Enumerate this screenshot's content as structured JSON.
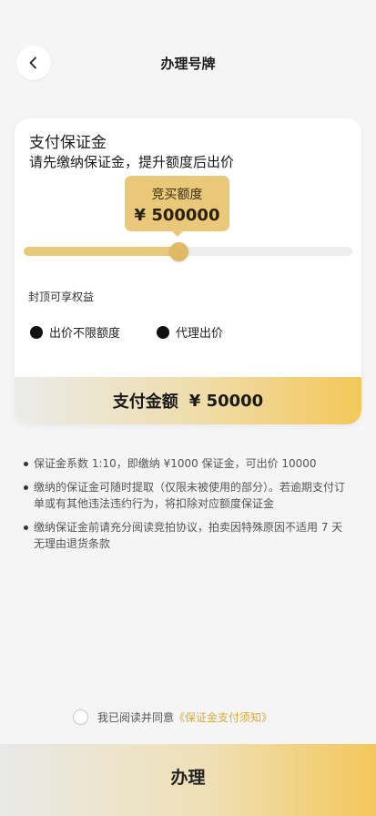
{
  "header": {
    "title": "办理号牌",
    "back_icon": "chevron-left-icon"
  },
  "card": {
    "title": "支付保证金",
    "subtitle": "请先缴纳保证金，提升额度后出价",
    "bid_limit": {
      "label": "竞买额度",
      "value": "¥ 500000"
    },
    "slider": {
      "fraction": 0.47
    },
    "perks": {
      "heading": "封顶可享权益",
      "items": [
        {
          "label": "出价不限额度"
        },
        {
          "label": "代理出价"
        }
      ]
    },
    "payment": {
      "label": "支付金额",
      "amount": "¥ 50000"
    }
  },
  "notes": [
    "保证金系数 1:10，即缴纳 ¥1000 保证金，可出价 10000",
    "缴纳的保证金可随时提取（仅限未被使用的部分）。若逾期支付订单或有其他违法违约行为，将扣除对应额度保证金",
    "缴纳保证金前请充分阅读竞拍协议，拍卖因特殊原因不适用 7 天无理由退货条款"
  ],
  "agreement": {
    "text": "我已阅读并同意",
    "link": "《保证金支付须知》",
    "checked": false
  },
  "submit": {
    "label": "办理"
  },
  "colors": {
    "accent": "#e9c979",
    "accent_strong": "#f3c75a",
    "link": "#d9a93a"
  }
}
